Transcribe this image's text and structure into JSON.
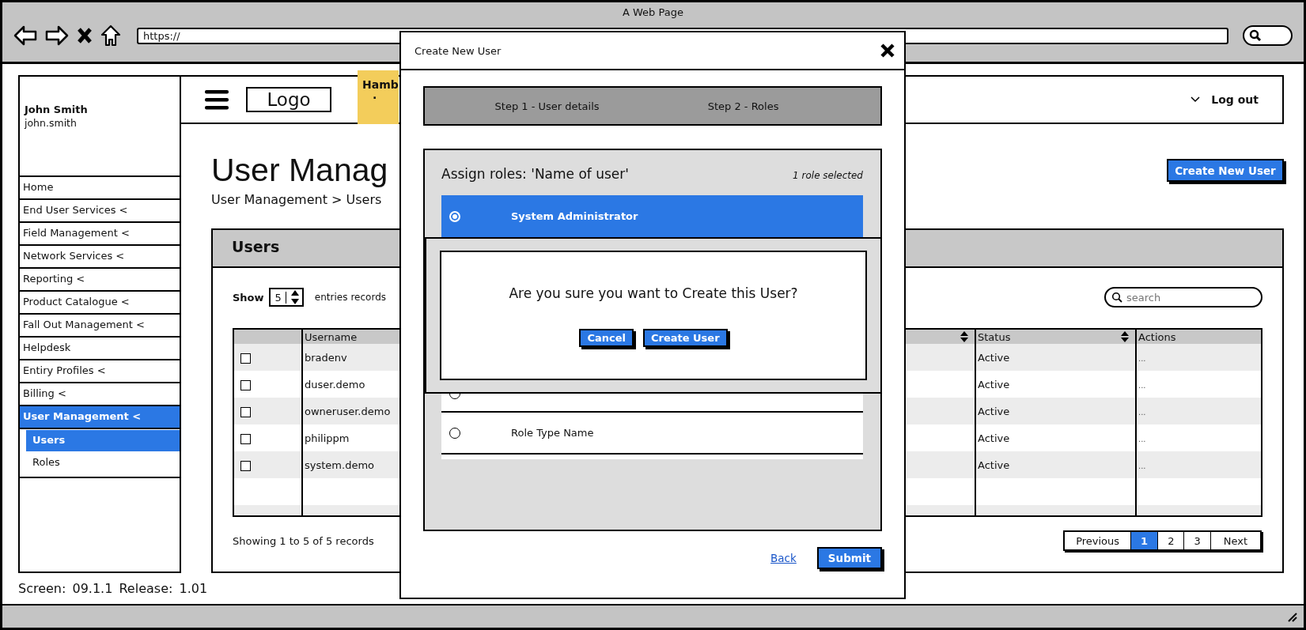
{
  "window": {
    "title": "A Web Page",
    "url": "https://"
  },
  "sidebar": {
    "user_name": "John Smith",
    "user_login": "john.smith",
    "items": [
      {
        "label": "Home",
        "selected": false
      },
      {
        "label": "End User Services <",
        "selected": false
      },
      {
        "label": "Field Management <",
        "selected": false
      },
      {
        "label": "Network Services <",
        "selected": false
      },
      {
        "label": "Reporting <",
        "selected": false
      },
      {
        "label": "Product Catalogue <",
        "selected": false
      },
      {
        "label": "Fall Out Management <",
        "selected": false
      },
      {
        "label": "Helpdesk",
        "selected": false
      },
      {
        "label": "Entiry Profiles <",
        "selected": false
      },
      {
        "label": "Billing <",
        "selected": false
      },
      {
        "label": "User Management <",
        "selected": true,
        "children": [
          {
            "label": "Users",
            "selected": true
          },
          {
            "label": "Roles",
            "selected": false
          }
        ]
      }
    ]
  },
  "header": {
    "logo": "Logo",
    "note_lines": [
      "Hamb",
      "."
    ],
    "logout": "Log out"
  },
  "page": {
    "title": "User Manag",
    "breadcrumb": "User Management > Users",
    "create_button": "Create New User"
  },
  "users_panel": {
    "title": "Users",
    "show_label": "Show",
    "page_size": "5",
    "entries_label": "entries",
    "records_label": "records",
    "search_placeholder": "search",
    "table": {
      "columns": [
        {
          "label": "Username",
          "sort_icon": false
        },
        {
          "sort_icon": true
        },
        {
          "label": "Status",
          "sort_icon": true
        },
        {
          "label": "Actions",
          "sort_icon": false
        }
      ],
      "rows": [
        {
          "checked": false,
          "username": "bradenv",
          "status": "Active",
          "actions": "..."
        },
        {
          "checked": false,
          "username": "duser.demo",
          "status": "Active",
          "actions": "..."
        },
        {
          "checked": false,
          "username": "owneruser.demo",
          "status": "Active",
          "actions": "..."
        },
        {
          "checked": false,
          "username": "philippm",
          "status": "Active",
          "actions": "..."
        },
        {
          "checked": false,
          "username": "system.demo",
          "status": "Active",
          "actions": "..."
        }
      ]
    },
    "summary": "Showing 1 to 5 of 5 records",
    "pagination": [
      {
        "label": "Previous",
        "selected": false
      },
      {
        "label": "1",
        "selected": true
      },
      {
        "label": "2",
        "selected": false
      },
      {
        "label": "3",
        "selected": false
      },
      {
        "label": "Next",
        "selected": false
      }
    ]
  },
  "footer": "Screen: 09.1.1 Release: 1.01",
  "modal": {
    "title": "Create New User",
    "steps": [
      "Step 1 - User details",
      "Step 2 - Roles"
    ],
    "roles_heading": "Assign roles: 'Name of user'",
    "roles_count": "1 role selected",
    "roles": [
      {
        "label": "System Administrator",
        "selected": true
      },
      {
        "selected": false
      },
      {
        "label": "Role Type Name",
        "selected": false
      }
    ],
    "back_link": "Back",
    "submit": "Submit"
  },
  "confirm": {
    "message": "Are you sure you want to Create this User?",
    "buttons": [
      "Cancel",
      "Create User"
    ]
  }
}
